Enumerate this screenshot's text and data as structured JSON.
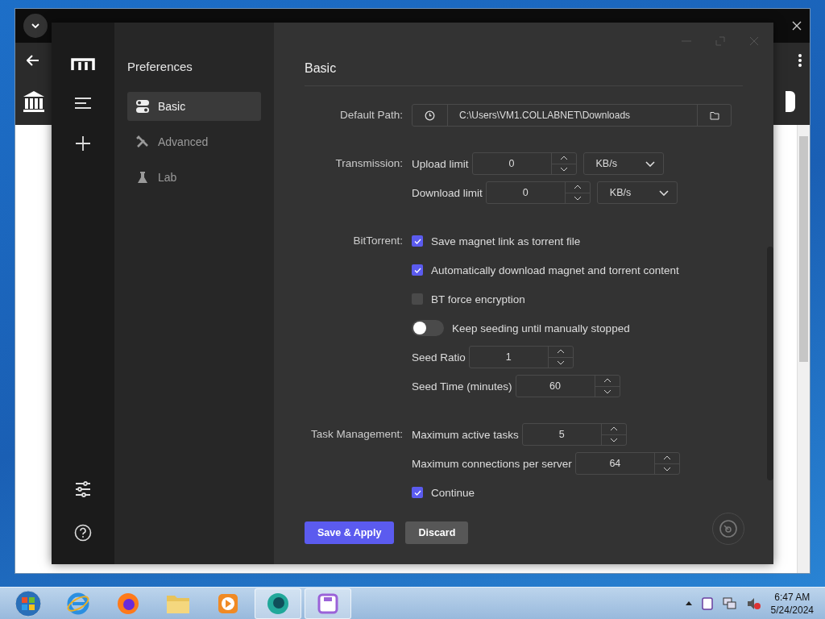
{
  "subnav": {
    "title": "Preferences",
    "items": [
      {
        "label": "Basic",
        "selected": true
      },
      {
        "label": "Advanced",
        "selected": false
      },
      {
        "label": "Lab",
        "selected": false
      }
    ]
  },
  "section_title": "Basic",
  "groups": [
    {
      "label": "Default Path:",
      "fields": [
        {
          "kind": "path",
          "value": "C:\\Users\\VM1.COLLABNET\\Downloads"
        }
      ]
    },
    {
      "label": "Transmission:",
      "fields": [
        {
          "kind": "number",
          "label": "Upload limit",
          "value": "0",
          "unit": "KB/s"
        },
        {
          "kind": "number",
          "label": "Download limit",
          "value": "0",
          "unit": "KB/s"
        }
      ]
    },
    {
      "label": "BitTorrent:",
      "fields": [
        {
          "kind": "checkbox",
          "label": "Save magnet link as torrent file",
          "checked": true
        },
        {
          "kind": "checkbox",
          "label": "Automatically download magnet and torrent content",
          "checked": true
        },
        {
          "kind": "checkbox",
          "label": "BT force encryption",
          "checked": false
        },
        {
          "kind": "switch",
          "label": "Keep seeding until manually stopped",
          "on": false
        },
        {
          "kind": "number",
          "label": "Seed Ratio",
          "value": "1"
        },
        {
          "kind": "number",
          "label": "Seed Time (minutes)",
          "value": "60"
        }
      ]
    },
    {
      "label": "Task Management:",
      "fields": [
        {
          "kind": "number",
          "label": "Maximum active tasks",
          "value": "5"
        },
        {
          "kind": "number",
          "label": "Maximum connections per server",
          "value": "64"
        },
        {
          "kind": "checkbox",
          "label": "Continue",
          "checked": true
        }
      ]
    }
  ],
  "buttons": [
    {
      "label": "Save & Apply",
      "kind": "primary"
    },
    {
      "label": "Discard",
      "kind": "secondary"
    }
  ],
  "taskbar": {
    "apps": [
      {
        "selected": false
      },
      {
        "selected": false
      },
      {
        "selected": false
      },
      {
        "selected": false
      },
      {
        "selected": true
      },
      {
        "selected": true
      }
    ],
    "time": "6:47 AM",
    "date": "5/24/2024"
  }
}
